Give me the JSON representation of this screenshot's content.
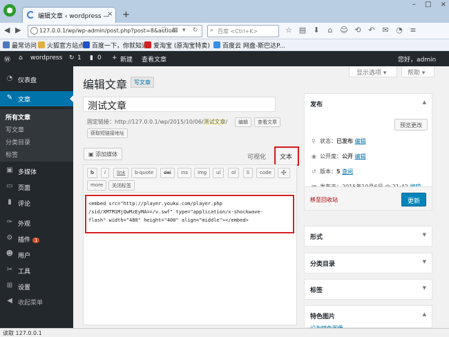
{
  "browser": {
    "tab_title": "编辑文章 ‹ wordpress —",
    "tab_close": "×",
    "new_tab": "+",
    "window_buttons": [
      "–",
      "□",
      "×"
    ],
    "url": "127.0.0.1/wp/wp-admin/post.php?post=8&action",
    "search_placeholder": "百度 <Ctrl+K>",
    "bookmarks": [
      "最常访问",
      "火狐官方站点",
      "百度一下，你就知道",
      "爱淘宝 (原淘宝特卖)",
      "百度云 网盘-斯巴达P..."
    ]
  },
  "adminbar": {
    "site_name": "wordpress",
    "updates": "1",
    "comments": "0",
    "new_label": "新建",
    "view_label": "查看文章",
    "greeting": "您好，admin"
  },
  "sidebar": {
    "items": [
      {
        "label": "仪表盘",
        "icon": "dashboard-icon"
      },
      {
        "label": "文章",
        "icon": "pin-icon"
      },
      {
        "label": "多媒体",
        "icon": "media-icon"
      },
      {
        "label": "页面",
        "icon": "page-icon"
      },
      {
        "label": "评论",
        "icon": "comment-icon"
      },
      {
        "label": "外观",
        "icon": "brush-icon"
      },
      {
        "label": "插件",
        "icon": "plugin-icon",
        "badge": "1"
      },
      {
        "label": "用户",
        "icon": "user-icon"
      },
      {
        "label": "工具",
        "icon": "wrench-icon"
      },
      {
        "label": "设置",
        "icon": "settings-icon"
      },
      {
        "label": "收起菜单",
        "icon": "collapse-icon"
      }
    ],
    "submenu": [
      "所有文章",
      "写文章",
      "分类目录",
      "标签"
    ]
  },
  "screen_options": "显示选项 ▾",
  "help": "帮助 ▾",
  "page_title": "编辑文章",
  "write_button": "写文章",
  "post_title": "测试文章",
  "permalink": {
    "label": "固定链接：",
    "base": "http://127.0.0.1/wp/2015/10/06/",
    "slug": "测试文章",
    "trail": "/",
    "edit_btn": "编辑",
    "view_btn": "查看文章",
    "shortlink_btn": "获取短链接地址"
  },
  "editor": {
    "add_media": "添加媒体",
    "tab_visual": "可视化",
    "tab_text": "文本",
    "quicktags": [
      "b",
      "i",
      "link",
      "b-quote",
      "del",
      "ins",
      "img",
      "ul",
      "ol",
      "li",
      "code",
      "more",
      "关闭标签"
    ],
    "content": "<embed src=\"http://player.youku.com/player.php\n/sid/XMTM1MjQwMzEyMA==/v.swf\" type=\"application/x-shockwave-\nflash\" width=\"480\" height=\"400\" align=\"middle\"></embed>"
  },
  "publish": {
    "title": "发布",
    "preview": "预览更改",
    "status_label": "状态：",
    "status_value": "已发布",
    "visibility_label": "公开度：",
    "visibility_value": "公开",
    "revisions_label": "版本：",
    "revisions_value": "5",
    "revisions_link": "查阅",
    "published_label": "发布于：",
    "published_value": "2015年10月6日 @ 21:42",
    "edit_link": "编辑",
    "trash": "移至回收站",
    "update": "更新"
  },
  "boxes": [
    "形式",
    "分类目录",
    "标签",
    "特色图片"
  ],
  "featured_link": "设为特色图像",
  "statusbar": "读取 127.0.0.1"
}
